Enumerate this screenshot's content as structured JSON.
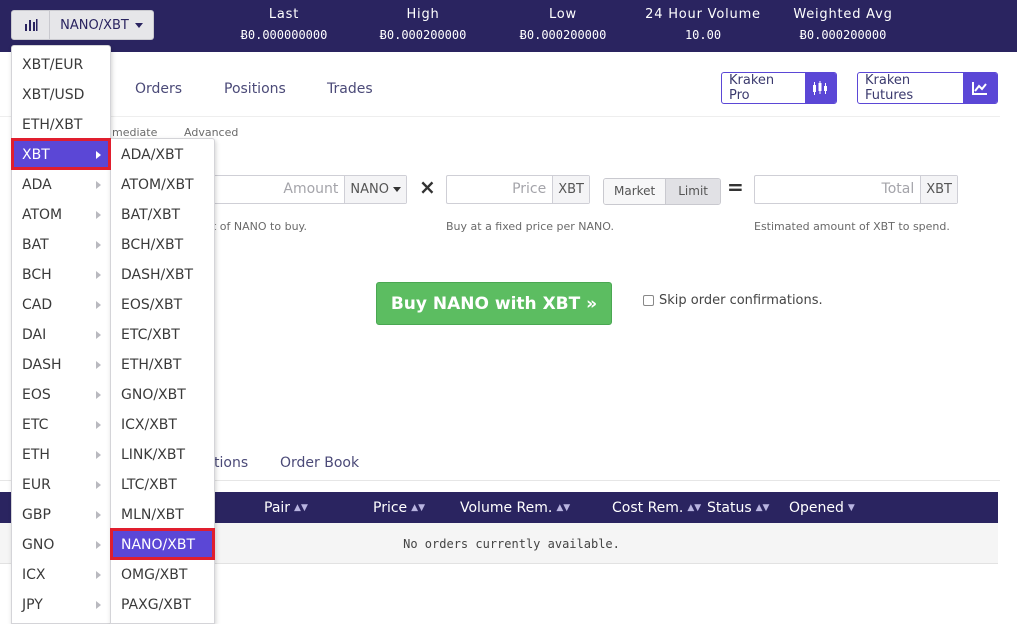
{
  "header": {
    "pair_selector": "NANO/XBT",
    "stats": [
      {
        "label": "Last",
        "value": "Ƀ0.000000000"
      },
      {
        "label": "High",
        "value": "Ƀ0.000200000"
      },
      {
        "label": "Low",
        "value": "Ƀ0.000200000"
      },
      {
        "label": "24 Hour Volume",
        "value": "10.00"
      },
      {
        "label": "Weighted Avg",
        "value": "Ƀ0.000200000"
      }
    ]
  },
  "tabs": [
    "Orders",
    "Positions",
    "Trades"
  ],
  "links": {
    "kraken_pro": "Kraken Pro",
    "kraken_futures": "Kraken Futures"
  },
  "order_modes": {
    "intermediate": "mediate",
    "advanced": "Advanced"
  },
  "form": {
    "amount_placeholder": "Amount",
    "amount_unit": "NANO",
    "amount_hint": "t of NANO to buy.",
    "price_placeholder": "Price",
    "price_unit": "XBT",
    "price_hint": "Buy at a fixed price per NANO.",
    "order_types": [
      "Market",
      "Limit"
    ],
    "selected_order_type": "Limit",
    "total_placeholder": "Total",
    "total_unit": "XBT",
    "total_hint": "Estimated amount of XBT to spend.",
    "multiply": "×",
    "equals": "=",
    "buy_button": "Buy NANO with XBT »",
    "skip_label": "Skip order confirmations."
  },
  "lower_tabs": [
    "tions",
    "Order Book"
  ],
  "table": {
    "columns": [
      "Pair",
      "Price",
      "Volume Rem.",
      "Cost Rem.",
      "Status",
      "Opened"
    ],
    "empty_message": "No orders currently available."
  },
  "dropdown": {
    "top_items": [
      "XBT/EUR",
      "XBT/USD",
      "ETH/XBT"
    ],
    "base_currencies": [
      "XBT",
      "ADA",
      "ATOM",
      "BAT",
      "BCH",
      "CAD",
      "DAI",
      "DASH",
      "EOS",
      "ETC",
      "ETH",
      "EUR",
      "GBP",
      "GNO",
      "ICX",
      "JPY"
    ],
    "active_base": "XBT",
    "submenu_pairs": [
      "ADA/XBT",
      "ATOM/XBT",
      "BAT/XBT",
      "BCH/XBT",
      "DASH/XBT",
      "EOS/XBT",
      "ETC/XBT",
      "ETH/XBT",
      "GNO/XBT",
      "ICX/XBT",
      "LINK/XBT",
      "LTC/XBT",
      "MLN/XBT",
      "NANO/XBT",
      "OMG/XBT",
      "PAXG/XBT"
    ],
    "selected_pair": "NANO/XBT"
  },
  "colors": {
    "brand": "#2a2460",
    "accent": "#5b47d6",
    "buy": "#5cbd61",
    "highlight": "#e01e2e"
  }
}
